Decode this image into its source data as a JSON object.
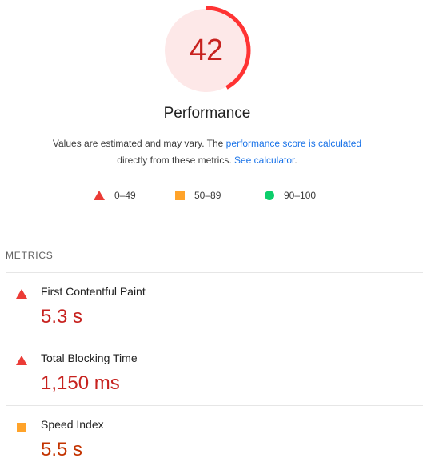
{
  "score": {
    "value": "42",
    "fraction": 0.42,
    "color": "#c7221f",
    "arc_color": "#ff3333",
    "bg_color": "#fde8e8"
  },
  "title": "Performance",
  "description": {
    "text1": "Values are estimated and may vary. The ",
    "link1": "performance score is calculated",
    "text2": "directly from these metrics. ",
    "link2": "See calculator",
    "text3": "."
  },
  "legend": [
    {
      "icon": "triangle-icon",
      "label": "0–49",
      "color": "#eb3b36"
    },
    {
      "icon": "square-icon",
      "label": "50–89",
      "color": "#ffa32a"
    },
    {
      "icon": "circle-icon",
      "label": "90–100",
      "color": "#0cce6b"
    }
  ],
  "metrics_header": "METRICS",
  "metrics": [
    {
      "name": "First Contentful Paint",
      "value": "5.3 s",
      "status": "fail",
      "icon": "triangle-icon"
    },
    {
      "name": "Total Blocking Time",
      "value": "1,150 ms",
      "status": "fail",
      "icon": "triangle-icon"
    },
    {
      "name": "Speed Index",
      "value": "5.5 s",
      "status": "average",
      "icon": "square-icon"
    }
  ]
}
